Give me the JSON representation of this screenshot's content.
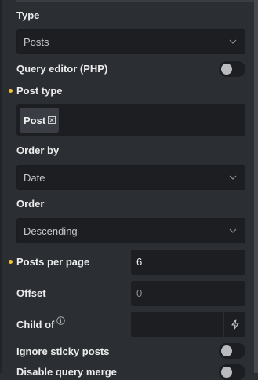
{
  "fields": {
    "type": {
      "label": "Type",
      "value": "Posts"
    },
    "query_editor": {
      "label": "Query editor (PHP)",
      "enabled": false
    },
    "post_type": {
      "label": "Post type",
      "tag": "Post"
    },
    "order_by": {
      "label": "Order by",
      "value": "Date"
    },
    "order": {
      "label": "Order",
      "value": "Descending"
    },
    "posts_per_page": {
      "label": "Posts per page",
      "value": "6"
    },
    "offset": {
      "label": "Offset",
      "placeholder": "0"
    },
    "child_of": {
      "label": "Child of",
      "value": ""
    },
    "ignore_sticky": {
      "label": "Ignore sticky posts",
      "enabled": false
    },
    "disable_query_merge": {
      "label": "Disable query merge",
      "enabled": false
    }
  },
  "icons": {
    "chevron": "chevron-down-icon",
    "tag_remove": "close-icon",
    "info": "info-icon",
    "dynamic_data": "bolt-icon",
    "modified_dot": "dot-indicator"
  },
  "colors": {
    "background": "#2b2e33",
    "input_bg": "#1c1e22",
    "accent_dot": "#f2c230",
    "toggle_knob": "#b9bbbe"
  }
}
